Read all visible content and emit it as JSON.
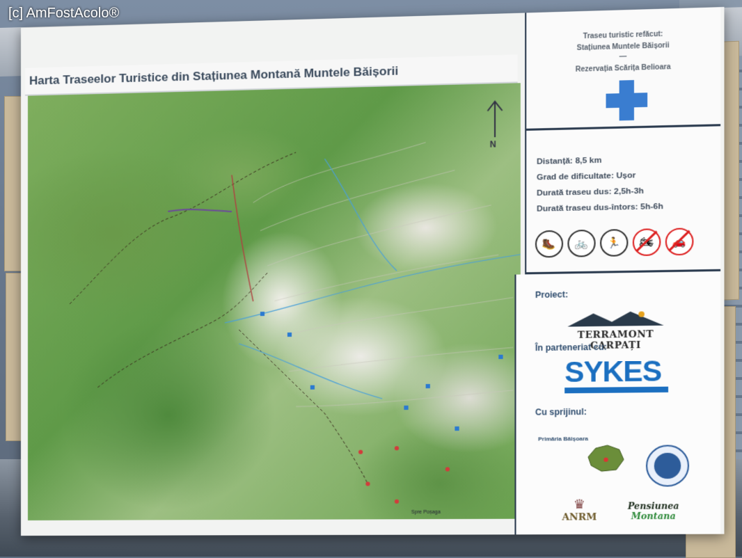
{
  "watermark": "[c] AmFostAcolo®",
  "board": {
    "title": "Harta Traseelor Turistice din Stațiunea Montană Muntele Băișorii",
    "north_label": "N"
  },
  "panel_top": {
    "line1": "Traseu turistic refăcut:",
    "line2": "Stațiunea Muntele Băișorii",
    "line3": "—",
    "line4": "Rezervația Scărița Belioara"
  },
  "trail_info": {
    "distance": "Distanță: 8,5 km",
    "difficulty": "Grad de dificultate: Ușor",
    "duration_one_way": "Durată traseu dus: 2,5h-3h",
    "duration_round_trip": "Durată traseu dus-întors: 5h-6h",
    "icons": [
      "hiking-icon",
      "cycling-icon",
      "running-icon",
      "no-motorbike-icon",
      "no-car-icon"
    ]
  },
  "sponsors": {
    "project_label": "Proiect:",
    "project_name": "TERRAMONT CARPAȚI",
    "partner_label": "În parteneriat cu:",
    "partner_name": "SYKES",
    "support_label": "Cu sprijinul:",
    "municipality": "Primăria Băișoara",
    "anrm": "ANRM",
    "pension_line1": "Pensiunea",
    "pension_line2": "Montana"
  },
  "map_labels": {
    "bottom_label": "Spre Poșaga"
  },
  "colors": {
    "title_text": "#3a4a5c",
    "panel_border": "#2b3b4f",
    "cross_blue": "#3a7dd0",
    "sykes_blue": "#1b6fc0"
  }
}
